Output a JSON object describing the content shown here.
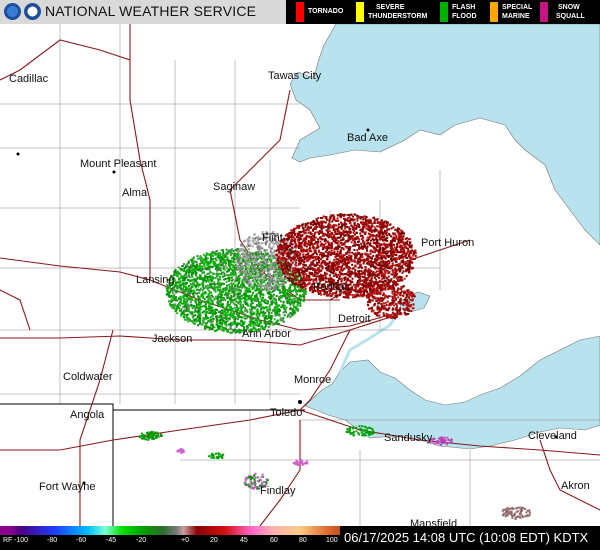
{
  "header": {
    "agency": "NATIONAL WEATHER SERVICE",
    "warnings": [
      {
        "label_line1": "TORNADO",
        "label_line2": "",
        "color": "#ff0000"
      },
      {
        "label_line1": "SEVERE",
        "label_line2": "THUNDERSTORM",
        "color": "#ffff00"
      },
      {
        "label_line1": "FLASH",
        "label_line2": "FLOOD",
        "color": "#00b000"
      },
      {
        "label_line1": "SPECIAL",
        "label_line2": "MARINE",
        "color": "#ffa500"
      },
      {
        "label_line1": "SNOW",
        "label_line2": "SQUALL",
        "color": "#c71585"
      }
    ]
  },
  "cities": [
    "Cadillac",
    "Tawas City",
    "Bad Axe",
    "Mount Pleasant",
    "Alma",
    "Saginaw",
    "Flint",
    "Port Huron",
    "Lansing",
    "Pontiac",
    "Detroit",
    "Jackson",
    "Ann Arbor",
    "Coldwater",
    "Monroe",
    "Angola",
    "Toledo",
    "Sandusky",
    "Cleveland",
    "Fort Wayne",
    "Findlay",
    "Akron",
    "Mansfield"
  ],
  "legend": {
    "ticks": [
      "RF",
      "-100",
      "-80",
      "-60",
      "-45",
      "-20",
      "+0",
      "20",
      "45",
      "60",
      "80",
      "100"
    ],
    "colors": {
      "rf": "#8b008b",
      "inbound": "#00a000",
      "outbound": "#8b0000",
      "water": "#b8e3ee",
      "roads": "#8b1a1a"
    }
  },
  "timestamp": "06/17/2025 14:08 UTC (10:08 EDT) KDTX"
}
